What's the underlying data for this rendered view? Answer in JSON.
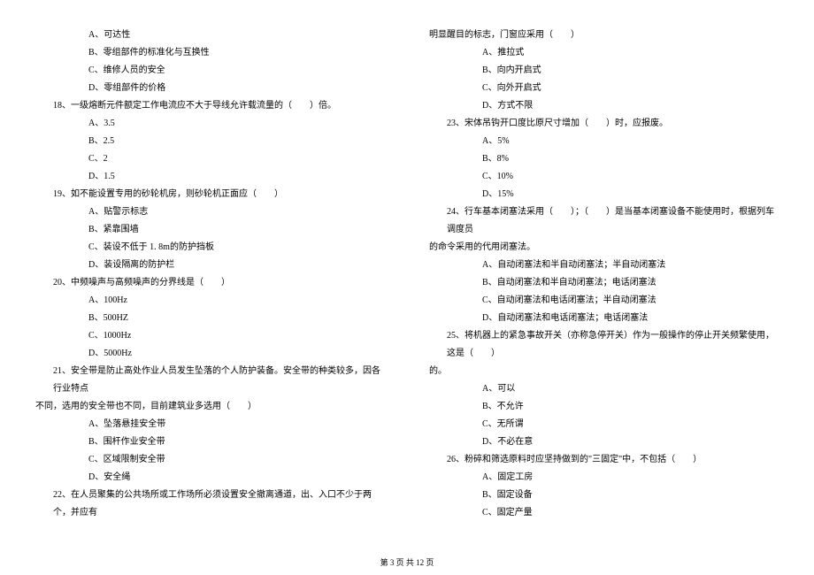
{
  "left_column": {
    "opts_17": [
      "A、可达性",
      "B、零组部件的标准化与互换性",
      "C、维修人员的安全",
      "D、零组部件的价格"
    ],
    "q18": "18、一级熔断元件额定工作电流应不大于导线允许载流量的（　　）倍。",
    "opts_18": [
      "A、3.5",
      "B、2.5",
      "C、2",
      "D、1.5"
    ],
    "q19": "19、如不能设置专用的砂轮机房，则砂轮机正面应（　　）",
    "opts_19": [
      "A、贴警示标志",
      "B、紧靠围墙",
      "C、装设不低于 1. 8m的防护挡板",
      "D、装设隔离的防护栏"
    ],
    "q20": "20、中频噪声与高频噪声的分界线是（　　）",
    "opts_20": [
      "A、100Hz",
      "B、500HZ",
      "C、1000Hz",
      "D、5000Hz"
    ],
    "q21_line1": "21、安全带是防止高处作业人员发生坠落的个人防护装备。安全带的种类较多，因各行业特点",
    "q21_line2": "不同，选用的安全带也不同，目前建筑业多选用（　　）",
    "opts_21": [
      "A、坠落悬挂安全带",
      "B、围杆作业安全带",
      "C、区域限制安全带",
      "D、安全绳"
    ],
    "q22": "22、在人员聚集的公共场所或工作场所必须设置安全撤离通道，出、入口不少于两个，并应有"
  },
  "right_column": {
    "q22_cont": "明显醒目的标志，门窗应采用（　　）",
    "opts_22": [
      "A、推拉式",
      "B、向内开启式",
      "C、向外开启式",
      "D、方式不限"
    ],
    "q23": "23、宋体吊钩开口度比原尺寸增加（　　）时，应报废。",
    "opts_23": [
      "A、5%",
      "B、8%",
      "C、10%",
      "D、15%"
    ],
    "q24_line1": "24、行车基本闭塞法采用（　　）；（　　）是当基本闭塞设备不能使用时，根据列车调度员",
    "q24_line2": "的命令采用的代用闭塞法。",
    "opts_24": [
      "A、自动闭塞法和半自动闭塞法；半自动闭塞法",
      "B、自动闭塞法和半自动闭塞法；电话闭塞法",
      "C、自动闭塞法和电话闭塞法；半自动闭塞法",
      "D、自动闭塞法和电话闭塞法；电话闭塞法"
    ],
    "q25_line1": "25、将机器上的紧急事故开关（亦称急停开关）作为一般操作的停止开关频繁使用，这是（　　）",
    "q25_line2": "的。",
    "opts_25": [
      "A、可以",
      "B、不允许",
      "C、无所谓",
      "D、不必在意"
    ],
    "q26": "26、粉碎和筛选原料时应坚持做到的\"三固定\"中，不包括（　　）",
    "opts_26": [
      "A、固定工房",
      "B、固定设备",
      "C、固定产量"
    ]
  },
  "footer": "第 3 页 共 12 页"
}
